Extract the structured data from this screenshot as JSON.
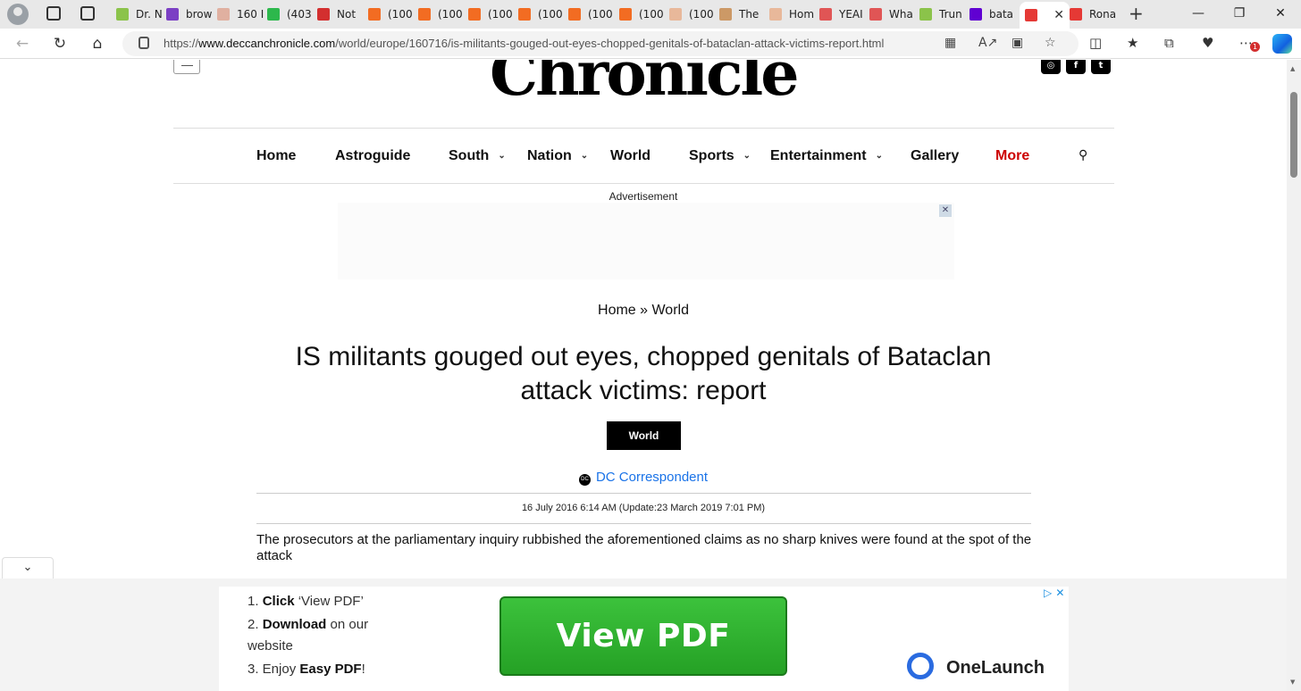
{
  "browser": {
    "tabs": [
      {
        "label": "Dr. N",
        "color": "#8bc34a"
      },
      {
        "label": "brow",
        "color": "#7b3fc4"
      },
      {
        "label": "160 I",
        "color": "#e0b0a0"
      },
      {
        "label": "(403",
        "color": "#2db84c"
      },
      {
        "label": "Not",
        "color": "#d32f2f"
      },
      {
        "label": "(100",
        "color": "#f26c22"
      },
      {
        "label": "(100",
        "color": "#f26c22"
      },
      {
        "label": "(100",
        "color": "#f26c22"
      },
      {
        "label": "(100",
        "color": "#f26c22"
      },
      {
        "label": "(100",
        "color": "#f26c22"
      },
      {
        "label": "(100",
        "color": "#f26c22"
      },
      {
        "label": "(100",
        "color": "#e8b89a"
      },
      {
        "label": "The",
        "color": "#c96"
      },
      {
        "label": "Hom",
        "color": "#e8b89a"
      },
      {
        "label": "YEAI",
        "color": "#e05555"
      },
      {
        "label": "Wha",
        "color": "#e05555"
      },
      {
        "label": "Trun",
        "color": "#8bc34a"
      },
      {
        "label": "bata",
        "color": "#6001d2"
      },
      {
        "label": "",
        "color": "#e53935"
      },
      {
        "label": "Rona",
        "color": "#e53935"
      }
    ],
    "url_prefix": "https://",
    "url_domain": "www.deccanchronicle.com",
    "url_path": "/world/europe/160716/is-militants-gouged-out-eyes-chopped-genitals-of-bataclan-attack-victims-report.html",
    "notification_count": "1"
  },
  "site": {
    "logo_text": "Chronicle",
    "social": [
      "◎",
      "f",
      "t"
    ]
  },
  "nav": {
    "items": [
      "Home",
      "Astroguide",
      "South",
      "Nation",
      "World",
      "Sports",
      "Entertainment",
      "Gallery",
      "More"
    ]
  },
  "ad": {
    "label": "Advertisement"
  },
  "article": {
    "breadcrumb": "Home » World",
    "headline": "IS militants gouged out eyes, chopped genitals of Bataclan attack victims: report",
    "category": "World",
    "author": "DC Correspondent",
    "author_icon": "DC",
    "dateline": "16 July 2016 6:14 AM (Update:23 March 2019 7:01 PM)",
    "summary": "The prosecutors at the parliamentary inquiry rubbished the aforementioned claims as no sharp knives were found at the spot of the attack"
  },
  "bottom_ad": {
    "step1_pre": "1. ",
    "step1_bold": "Click",
    "step1_post": " ‘View PDF’",
    "step2_pre": "2. ",
    "step2_bold": "Download",
    "step2_post": " on our",
    "step2_line2": "website",
    "step3_pre": "3. Enjoy ",
    "step3_bold": "Easy PDF",
    "step3_post": "!",
    "button_label": "View PDF",
    "brand": "OneLaunch"
  }
}
